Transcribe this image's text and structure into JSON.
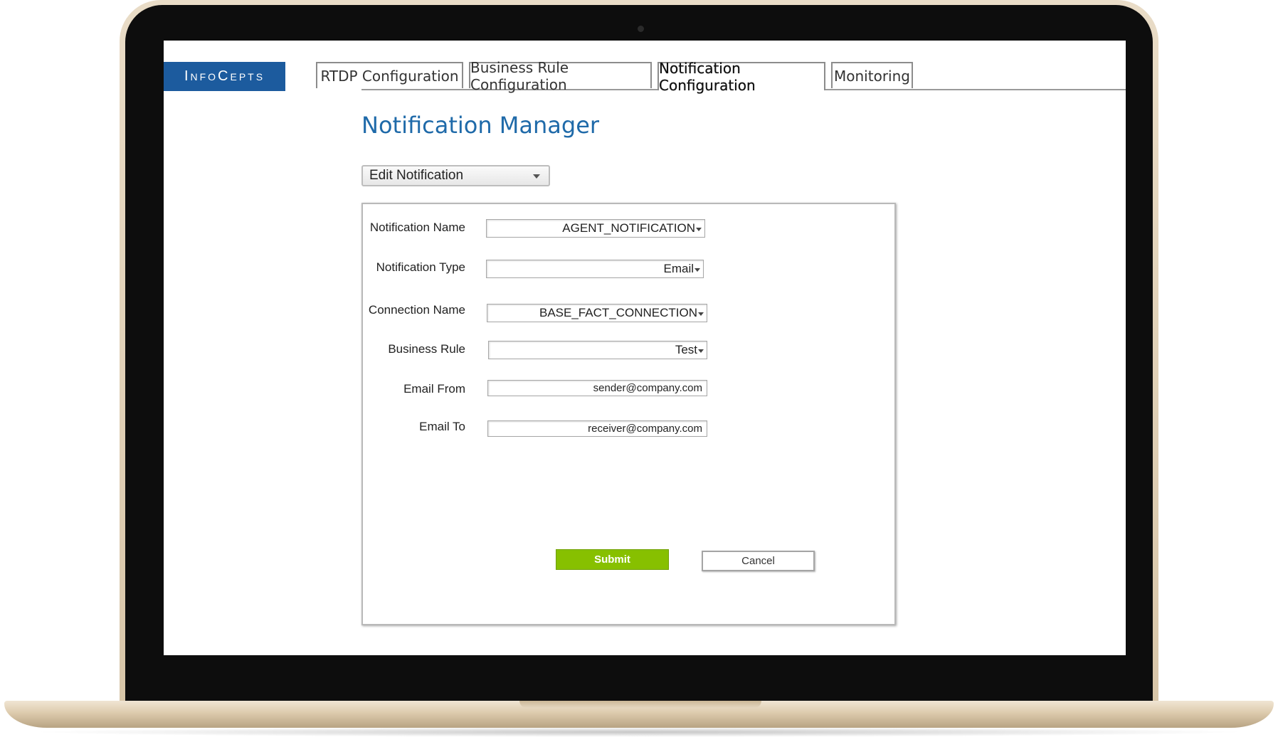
{
  "brand": {
    "logo_text": "InfoCepts"
  },
  "tabs": [
    {
      "label": "RTDP Configuration",
      "active": false
    },
    {
      "label": "Business Rule Configuration",
      "active": false
    },
    {
      "label": "Notification Configuration",
      "active": true
    },
    {
      "label": "Monitoring",
      "active": false
    }
  ],
  "page": {
    "title": "Notification Manager",
    "mode_select": {
      "value": "Edit Notification"
    }
  },
  "form": {
    "fields": [
      {
        "label": "Notification Name",
        "value": "AGENT_NOTIFICATION",
        "kind": "select"
      },
      {
        "label": "Notification Type",
        "value": "Email",
        "kind": "select"
      },
      {
        "label": "Connection Name",
        "value": "BASE_FACT_CONNECTION",
        "kind": "select"
      },
      {
        "label": "Business Rule",
        "value": "Test",
        "kind": "select"
      },
      {
        "label": "Email From",
        "value": "sender@company.com",
        "kind": "text"
      },
      {
        "label": "Email To",
        "value": "receiver@company.com",
        "kind": "text"
      }
    ],
    "submit_label": "Submit",
    "cancel_label": "Cancel"
  },
  "colors": {
    "brand_blue": "#1c5b9e",
    "title_blue": "#1f6aa9",
    "submit_green": "#87c000"
  }
}
